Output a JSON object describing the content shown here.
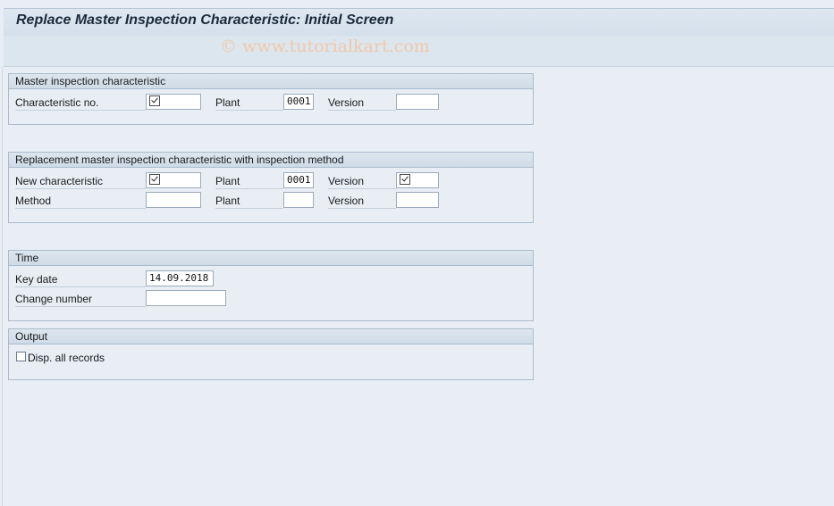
{
  "window": {
    "title": "Replace Master Inspection Characteristic: Initial Screen"
  },
  "watermark": "© www.tutorialkart.com",
  "groups": {
    "master": {
      "title": "Master inspection characteristic",
      "char_label": "Characteristic no.",
      "plant_label": "Plant",
      "plant_value": "0001",
      "version_label": "Version"
    },
    "replacement": {
      "title": "Replacement master inspection characteristic with inspection method",
      "new_char_label": "New characteristic",
      "plant_label": "Plant",
      "plant_value": "0001",
      "version_label": "Version",
      "method_label": "Method",
      "method_plant_label": "Plant",
      "method_version_label": "Version"
    },
    "time": {
      "title": "Time",
      "key_date_label": "Key date",
      "key_date_value": "14.09.2018",
      "change_number_label": "Change number"
    },
    "output": {
      "title": "Output",
      "disp_all_label": "Disp. all records",
      "disp_all_checked": false
    }
  }
}
